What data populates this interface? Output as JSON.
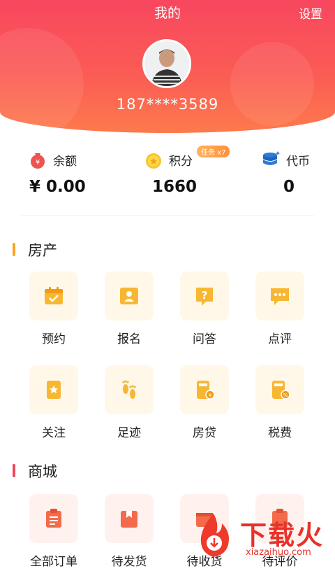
{
  "header": {
    "title": "我的",
    "settings_label": "设置",
    "phone": "187****3589"
  },
  "stats": {
    "balance": {
      "label": "余额",
      "value": "¥ 0.00",
      "icon": "money-bag-icon"
    },
    "points": {
      "label": "积分",
      "value": "1660",
      "badge": "任务 x7",
      "icon": "coin-icon"
    },
    "tokens": {
      "label": "代币",
      "value": "0",
      "icon": "coin-stack-icon"
    }
  },
  "sections": {
    "property": {
      "title": "房产",
      "accent": "#f5a623",
      "items": [
        {
          "label": "预约",
          "icon": "calendar-check-icon"
        },
        {
          "label": "报名",
          "icon": "id-card-icon"
        },
        {
          "label": "问答",
          "icon": "question-icon"
        },
        {
          "label": "点评",
          "icon": "comment-icon"
        },
        {
          "label": "关注",
          "icon": "bookmark-star-icon"
        },
        {
          "label": "足迹",
          "icon": "footprint-icon"
        },
        {
          "label": "房贷",
          "icon": "loan-calculator-icon"
        },
        {
          "label": "税费",
          "icon": "tax-calculator-icon"
        }
      ]
    },
    "mall": {
      "title": "商城",
      "accent": "#f0475b",
      "items": [
        {
          "label": "全部订单",
          "icon": "order-list-icon"
        },
        {
          "label": "待发货",
          "icon": "package-icon"
        },
        {
          "label": "待收货",
          "icon": "delivery-icon"
        },
        {
          "label": "待评价",
          "icon": "review-icon"
        }
      ]
    }
  },
  "watermark": {
    "text": "下载火",
    "url": "xiazaihuo.com"
  }
}
